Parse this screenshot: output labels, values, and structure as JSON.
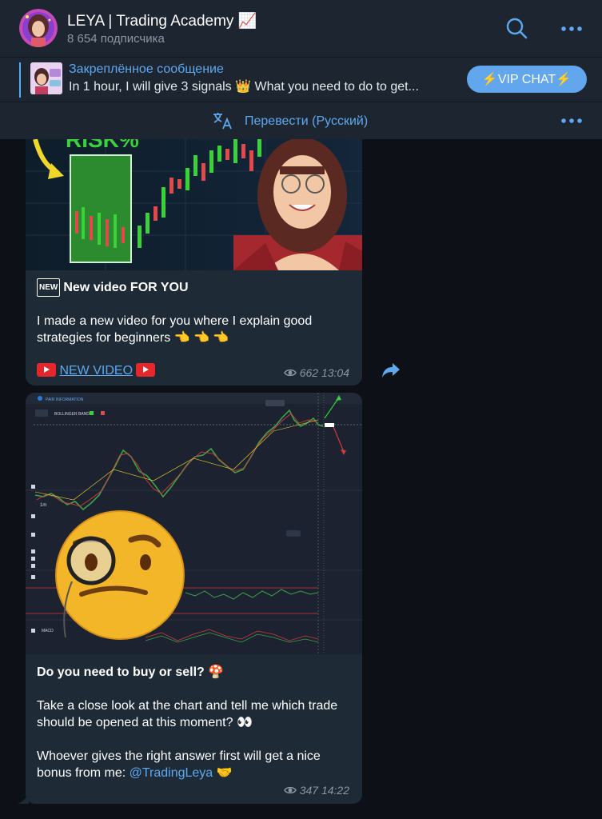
{
  "header": {
    "title": "LEYA | Trading Academy 📈",
    "subscribers": "8 654 подписчика"
  },
  "pinned": {
    "title": "Закреплённое сообщение",
    "text": "In 1 hour, I will give 3 signals 👑  What you need to do to get...",
    "vip_button": "⚡️VIP CHAT⚡️"
  },
  "translate": {
    "label": "Перевести (Русский)"
  },
  "messages": [
    {
      "title": "New video FOR YOU",
      "new_badge": "NEW",
      "image_text": "RISK%",
      "body": "I made a new video for you where I explain good strategies for beginners 👈 👈 👈",
      "link_text": "NEW VIDEO",
      "views": "662",
      "time": "13:04"
    },
    {
      "title": "Do you need to buy or sell? 🍄",
      "body1": "Take a close look at the chart and tell me which trade should be opened at this moment? 👀",
      "body2_prefix": "Whoever gives the right answer first will get a nice bonus from me: ",
      "mention": "@TradingLeya",
      "body2_suffix": " 🤝",
      "views": "347",
      "time": "14:22",
      "chart_labels": {
        "pair": "PAIR INFORMATION",
        "indicator": "BOLLINGER BANDS",
        "macd": "MACD",
        "timeframe": "1m"
      }
    }
  ],
  "colors": {
    "accent": "#5ea8f0",
    "bubble": "#1e2a36",
    "header": "#1c2530",
    "background": "#0d1117"
  }
}
